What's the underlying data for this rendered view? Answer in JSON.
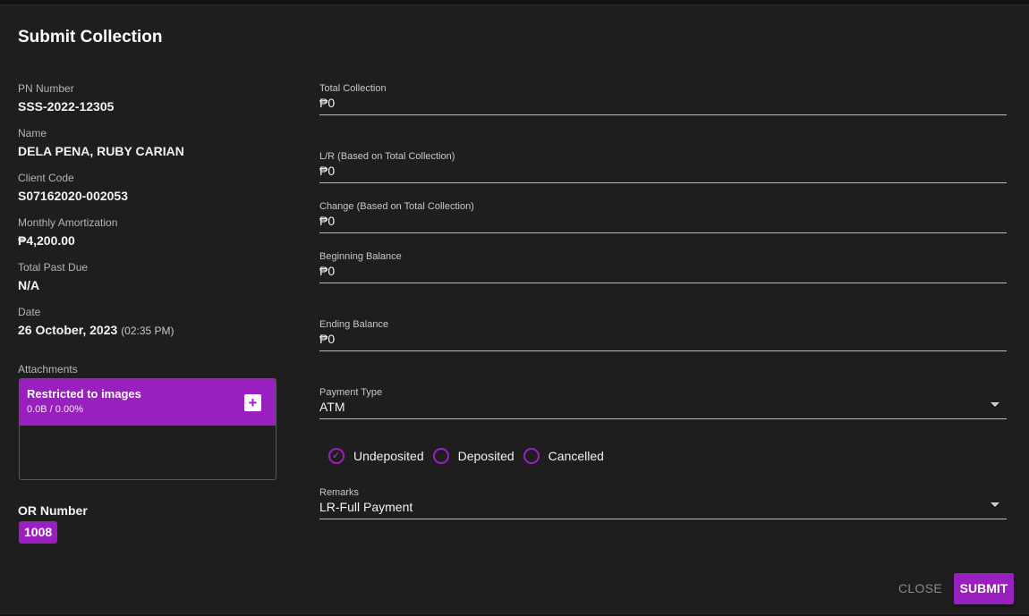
{
  "dialog": {
    "title": "Submit Collection"
  },
  "info": {
    "pn_label": "PN Number",
    "pn_value": "SSS-2022-12305",
    "name_label": "Name",
    "name_value": "DELA PENA, RUBY CARIAN",
    "client_label": "Client Code",
    "client_value": "S07162020-002053",
    "amort_label": "Monthly Amortization",
    "amort_value": "₱4,200.00",
    "pastdue_label": "Total Past Due",
    "pastdue_value": "N/A",
    "date_label": "Date",
    "date_value": "26 October, 2023",
    "date_time": "(02:35 PM)"
  },
  "attachments": {
    "label": "Attachments",
    "title": "Restricted to images",
    "meta": "0.0B / 0.00%",
    "add_icon": "+"
  },
  "or": {
    "label": "OR Number",
    "value": "1008"
  },
  "fields": {
    "total_collection": {
      "label": "Total Collection",
      "value": "₱0"
    },
    "lr": {
      "label": "L/R (Based on Total Collection)",
      "value": "₱0"
    },
    "change": {
      "label": "Change (Based on Total Collection)",
      "value": "₱0"
    },
    "beginning": {
      "label": "Beginning Balance",
      "value": "₱0"
    },
    "ending": {
      "label": "Ending Balance",
      "value": "₱0"
    },
    "payment_type": {
      "label": "Payment Type",
      "value": "ATM"
    },
    "remarks": {
      "label": "Remarks",
      "value": "LR-Full Payment"
    }
  },
  "status": {
    "options": [
      "Undeposited",
      "Deposited",
      "Cancelled"
    ],
    "selected": "Undeposited",
    "check_icon": "✓"
  },
  "actions": {
    "close": "CLOSE",
    "submit": "SUBMIT"
  },
  "colors": {
    "accent": "#9a1fbf",
    "background": "#1e1e1f"
  }
}
